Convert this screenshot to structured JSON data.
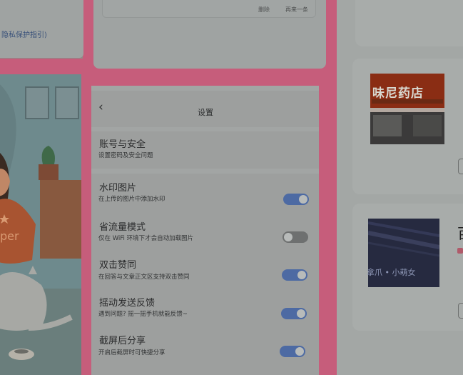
{
  "topleft": {
    "privacy_link": "隐私保护指引)"
  },
  "topmiddle": {
    "btn_delete": "删除",
    "btn_next": "再来一条"
  },
  "settings": {
    "back": "‹",
    "title": "设置",
    "account": {
      "title": "账号与安全",
      "subtitle": "设置密码及安全问题"
    },
    "toggles": [
      {
        "title": "水印图片",
        "subtitle": "在上传的图片中添加水印",
        "on": true
      },
      {
        "title": "省流量模式",
        "subtitle": "仅在 WiFi 环境下才会自动加载图片",
        "on": false
      },
      {
        "title": "双击赞同",
        "subtitle": "在回答与文章正文区支持双击赞同",
        "on": true
      },
      {
        "title": "摇动发送反馈",
        "subtitle": "遇到问题? 摇一摇手机就能反馈~",
        "on": true
      },
      {
        "title": "截屏后分享",
        "subtitle": "开启后截屏时可快捷分享",
        "on": true
      }
    ]
  },
  "right": {
    "shop_sign": "味尼药店",
    "image2_caption": "拿爪 • 小萌女",
    "card3_title_partial": "百"
  },
  "colors": {
    "frame_pink": "#c65d7b",
    "toggle_on": "#4d6aa3",
    "toggle_off": "#6e7070"
  }
}
